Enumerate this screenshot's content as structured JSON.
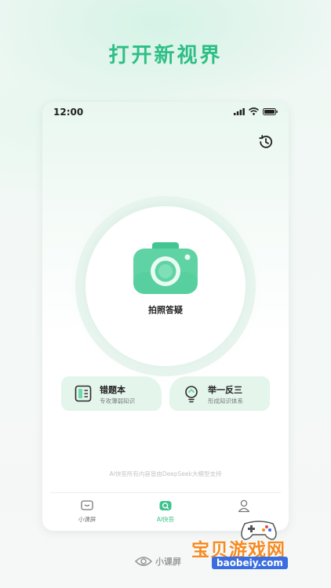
{
  "headline": "打开新视界",
  "status_bar": {
    "time": "12:00",
    "icons": [
      "signal-icon",
      "wifi-icon",
      "battery-icon"
    ]
  },
  "history_icon": "history-clock-icon",
  "camera": {
    "icon": "camera-icon",
    "label": "拍照答疑"
  },
  "features": [
    {
      "title": "错题本",
      "subtitle": "专攻薄弱知识",
      "icon": "notebook-icon"
    },
    {
      "title": "举一反三",
      "subtitle": "形成知识体系",
      "icon": "lightbulb-icon"
    }
  ],
  "disclaimer": "AI快答所有内容皆由DeepSeek大模型支持",
  "tabs": [
    {
      "label": "小课屏",
      "icon": "screen-icon",
      "active": false
    },
    {
      "label": "AI快答",
      "icon": "search-camera-icon",
      "active": true
    },
    {
      "label": "",
      "icon": "profile-icon",
      "active": false
    }
  ],
  "brand": {
    "name": "小课屏",
    "icon": "brand-eye-icon"
  },
  "watermark": {
    "title": "宝贝游戏网",
    "url": "baobeiy.com",
    "icon": "gamepad-icon"
  },
  "colors": {
    "accent": "#3cc38e",
    "headline": "#2fbf86",
    "card_bg": "#e4f5ec",
    "camera_green": "#5fd3a3",
    "watermark_orange": "#f48b23",
    "watermark_blue": "#3a6ee0"
  }
}
